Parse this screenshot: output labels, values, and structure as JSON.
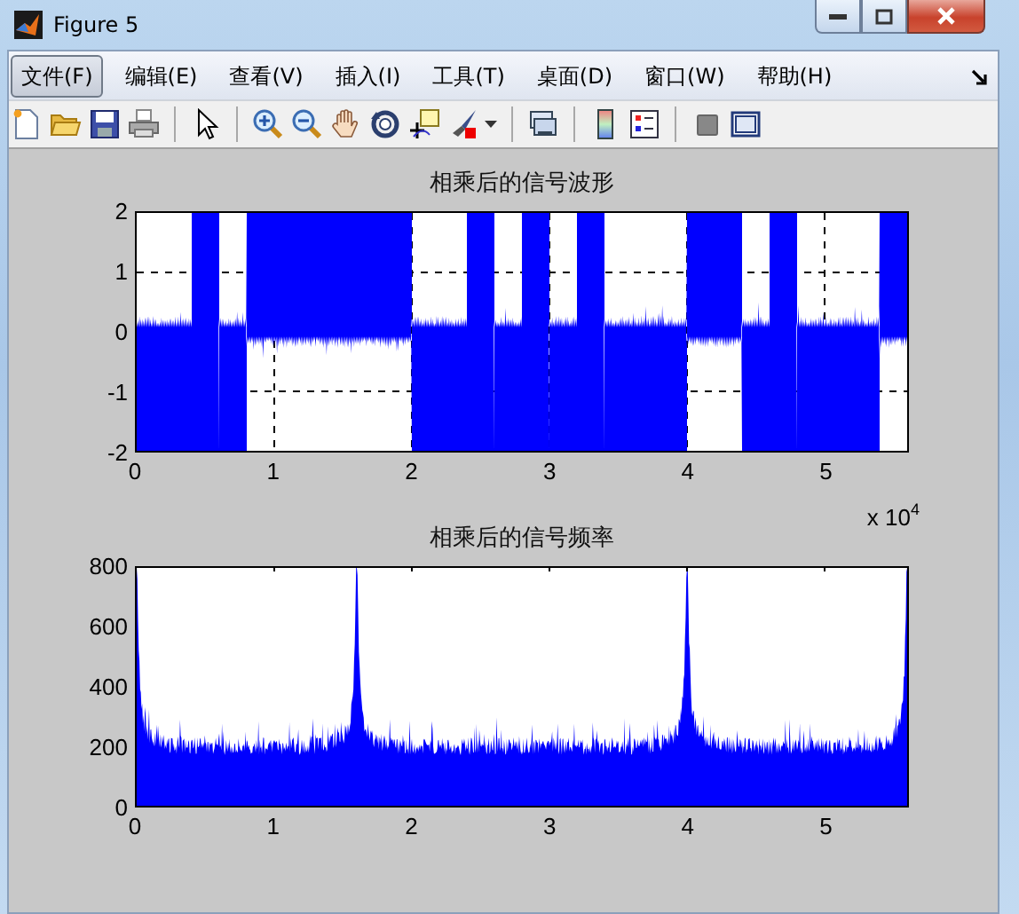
{
  "window": {
    "title": "Figure 5"
  },
  "menu": [
    {
      "label": "文件(F)",
      "selected": true
    },
    {
      "label": "编辑(E)",
      "selected": false
    },
    {
      "label": "查看(V)",
      "selected": false
    },
    {
      "label": "插入(I)",
      "selected": false
    },
    {
      "label": "工具(T)",
      "selected": false
    },
    {
      "label": "桌面(D)",
      "selected": false
    },
    {
      "label": "窗口(W)",
      "selected": false
    },
    {
      "label": "帮助(H)",
      "selected": false
    }
  ],
  "toolbar": [
    {
      "kind": "new"
    },
    {
      "kind": "open"
    },
    {
      "kind": "save"
    },
    {
      "kind": "print"
    },
    {
      "kind": "separator"
    },
    {
      "kind": "pointer"
    },
    {
      "kind": "separator"
    },
    {
      "kind": "zoom-in"
    },
    {
      "kind": "zoom-out"
    },
    {
      "kind": "pan"
    },
    {
      "kind": "rotate"
    },
    {
      "kind": "cursor"
    },
    {
      "kind": "brush"
    },
    {
      "kind": "separator"
    },
    {
      "kind": "link"
    },
    {
      "kind": "separator"
    },
    {
      "kind": "colorbar"
    },
    {
      "kind": "legend"
    },
    {
      "kind": "separator"
    },
    {
      "kind": "hide"
    },
    {
      "kind": "tools"
    }
  ],
  "plots": [
    {
      "kind": "waveform",
      "title": "相乘后的信号波形",
      "yticks": [
        "2",
        "1",
        "0",
        "-1",
        "-2"
      ],
      "xticks": [
        "0",
        "1",
        "2",
        "3",
        "4",
        "5"
      ],
      "multiplier": "x 10$^{4}$"
    },
    {
      "kind": "spectrum",
      "title": "相乘后的信号频率",
      "yticks": [
        "800",
        "600",
        "400",
        "200",
        "0"
      ],
      "xticks": [
        "0",
        "1",
        "2",
        "3",
        "4",
        "5"
      ]
    }
  ]
}
